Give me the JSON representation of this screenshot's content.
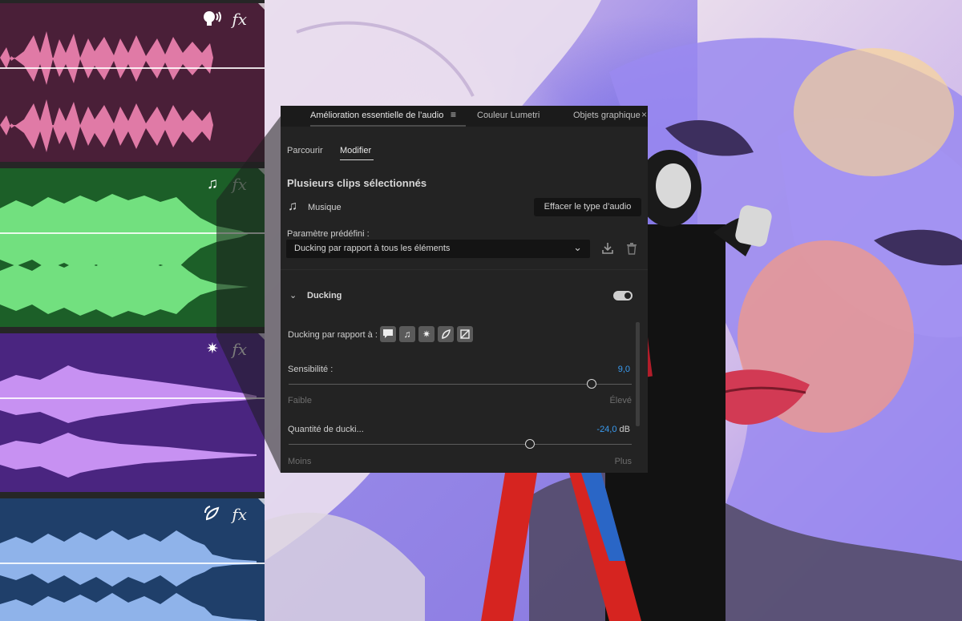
{
  "tracks": [
    {
      "type": "dialogue",
      "color": "#4a1f38",
      "wave_color": "#e07aa6",
      "icon": "dialogue-icon",
      "fx": "fx"
    },
    {
      "type": "music",
      "color": "#1c5f28",
      "wave_color": "#72e07f",
      "icon": "music-note-icon",
      "fx": "fx"
    },
    {
      "type": "sfx",
      "color": "#4a2580",
      "wave_color": "#c791f2",
      "icon": "sfx-burst-icon",
      "fx": "fx"
    },
    {
      "type": "ambience",
      "color": "#1f3f6a",
      "wave_color": "#8fb3ea",
      "icon": "ambience-icon",
      "fx": "fx"
    }
  ],
  "panel": {
    "tabs": {
      "active": "Amélioration essentielle de l’audio",
      "menu": "≡",
      "lumetri": "Couleur Lumetri",
      "objets": "Objets graphique",
      "close": "×"
    },
    "subtabs": {
      "parcourir": "Parcourir",
      "modifier": "Modifier"
    },
    "heading": "Plusieurs clips sélectionnés",
    "audio_type": "Musique",
    "clear_button": "Effacer le type d’audio",
    "preset_label": "Paramètre prédéfini :",
    "preset_value": "Ducking par rapport à tous les éléments",
    "section": {
      "title": "Ducking",
      "enabled": true
    },
    "duck_against_label": "Ducking par rapport à :",
    "duck_against_icons": [
      "dialogue-icon",
      "music-icon",
      "sfx-icon",
      "ambience-icon",
      "unknown-icon"
    ],
    "sensitivity": {
      "label": "Sensibilité :",
      "value": "9,0",
      "min_label": "Faible",
      "max_label": "Élevé",
      "position": 0.885
    },
    "amount": {
      "label": "Quantité de ducki...",
      "value": "-24,0",
      "unit": " dB",
      "min_label": "Moins",
      "max_label": "Plus",
      "position": 0.705
    }
  }
}
